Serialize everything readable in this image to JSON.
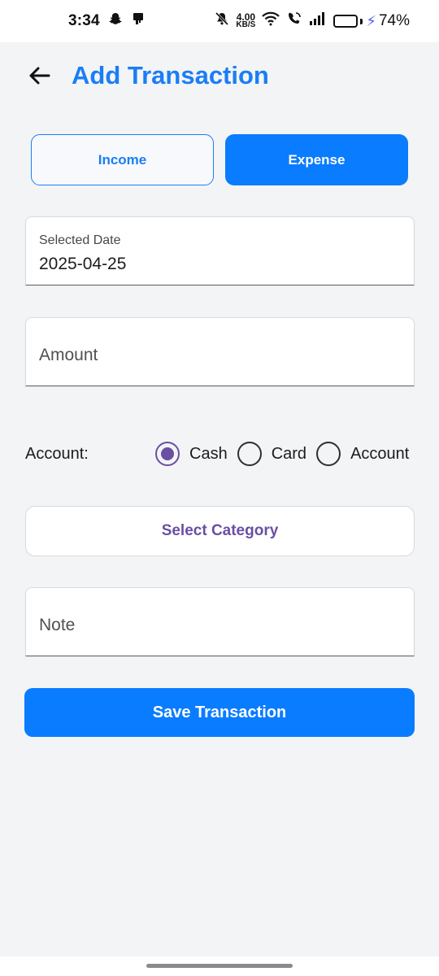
{
  "status_bar": {
    "time": "3:34",
    "speed_value": "4.00",
    "speed_unit": "KB/S",
    "battery_percent": "74%",
    "battery_level": 0.74,
    "icons": [
      "snapchat-icon",
      "notification-icon",
      "mute-icon",
      "wifi-icon",
      "call-icon",
      "signal-icon",
      "battery-icon",
      "charging-icon"
    ]
  },
  "header": {
    "title": "Add Transaction",
    "back_icon": "arrow-left-icon"
  },
  "type_toggle": {
    "income_label": "Income",
    "expense_label": "Expense",
    "selected": "Expense"
  },
  "date_field": {
    "label": "Selected Date",
    "value": "2025-04-25"
  },
  "amount_field": {
    "placeholder": "Amount",
    "value": ""
  },
  "account": {
    "label": "Account:",
    "options": [
      "Cash",
      "Card",
      "Account"
    ],
    "selected": "Cash"
  },
  "category_button": {
    "label": "Select Category"
  },
  "note_field": {
    "placeholder": "Note",
    "value": ""
  },
  "save_button": {
    "label": "Save Transaction"
  },
  "colors": {
    "primary": "#0a7cff",
    "title": "#1a7ef5",
    "accent": "#6a4fa3",
    "background": "#f3f4f6"
  }
}
